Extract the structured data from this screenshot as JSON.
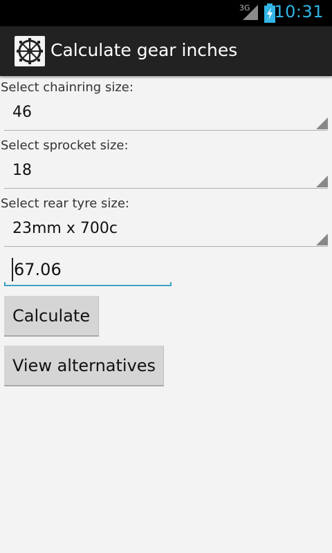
{
  "status_bar": {
    "network": "3G",
    "time": "10:31",
    "signal_icon": "signal-icon",
    "battery_icon": "battery-charging-icon",
    "clock_color": "#33b5e5"
  },
  "action_bar": {
    "title": "Calculate gear inches",
    "app_icon": "bicycle-gear-icon"
  },
  "form": {
    "chainring": {
      "label": "Select chainring size:",
      "value": "46"
    },
    "sprocket": {
      "label": "Select sprocket size:",
      "value": "18"
    },
    "tyre": {
      "label": "Select rear tyre size:",
      "value": "23mm x 700c"
    },
    "result": {
      "value": "67.06"
    }
  },
  "buttons": {
    "calculate": "Calculate",
    "alternatives": "View alternatives"
  },
  "colors": {
    "accent": "#33b5e5",
    "action_bar_bg": "#222222",
    "background": "#f3f3f3"
  }
}
